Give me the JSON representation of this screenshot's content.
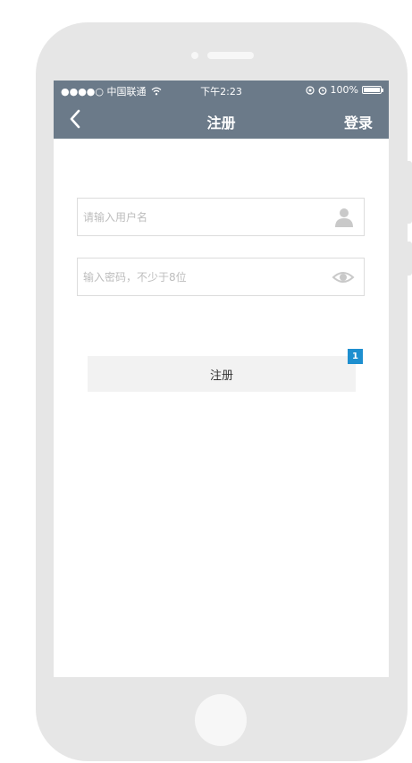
{
  "status_bar": {
    "carrier": "●●●●○ 中国联通",
    "wifi_icon": "wifi-icon",
    "time": "下午2:23",
    "battery_percent": "100%"
  },
  "nav": {
    "back_icon": "chevron-left-icon",
    "title": "注册",
    "login_label": "登录"
  },
  "form": {
    "username_placeholder": "请输入用户名",
    "username_value": "",
    "password_placeholder": "输入密码，不少于8位",
    "password_value": "",
    "user_icon": "user-icon",
    "eye_icon": "eye-icon",
    "submit_label": "注册",
    "badge_count": "1"
  },
  "colors": {
    "header": "#6b7a89",
    "badge": "#1e8fcf",
    "phone_frame": "#e6e6e6"
  }
}
